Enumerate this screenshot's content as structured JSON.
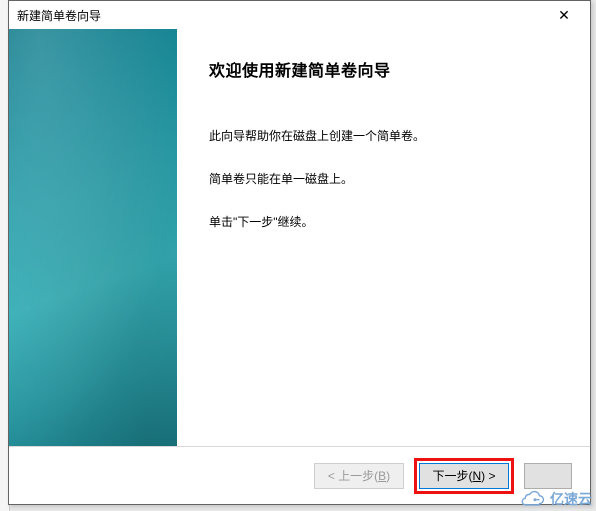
{
  "dialog": {
    "title": "新建简单卷向导",
    "close_glyph": "✕"
  },
  "content": {
    "heading": "欢迎使用新建简单卷向导",
    "para1": "此向导帮助你在磁盘上创建一个简单卷。",
    "para2": "简单卷只能在单一磁盘上。",
    "para3": "单击\"下一步\"继续。"
  },
  "buttons": {
    "back_prefix": "< 上一步(",
    "back_accel": "B",
    "back_suffix": ")",
    "next_prefix": "下一步(",
    "next_accel": "N",
    "next_suffix": ") >"
  },
  "watermark": {
    "text": "亿速云"
  }
}
